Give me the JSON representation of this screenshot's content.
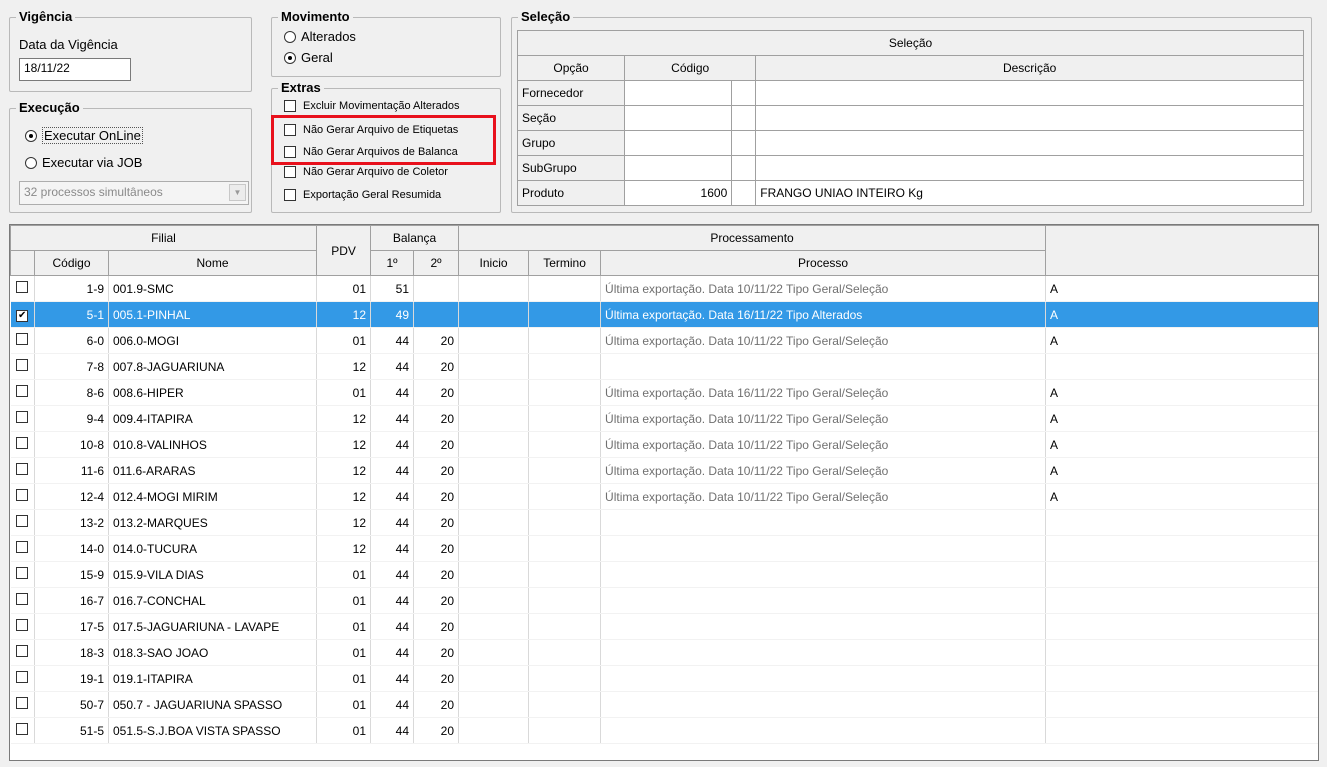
{
  "vigencia": {
    "legend": "Vigência",
    "label": "Data da Vigência",
    "value": "18/11/22"
  },
  "execucao": {
    "legend": "Execução",
    "options": [
      {
        "label": "Executar OnLine",
        "selected": true
      },
      {
        "label": "Executar via JOB",
        "selected": false
      }
    ],
    "combo_value": "32 processos simultâneos"
  },
  "movimento": {
    "legend": "Movimento",
    "options": [
      {
        "label": "Alterados",
        "selected": false
      },
      {
        "label": "Geral",
        "selected": true
      }
    ]
  },
  "extras": {
    "legend": "Extras",
    "options": [
      {
        "label": "Excluir Movimentação Alterados",
        "checked": false
      },
      {
        "label": "Não Gerar Arquivo de Etiquetas",
        "checked": false
      },
      {
        "label": "Não Gerar Arquivos de Balanca",
        "checked": false
      },
      {
        "label": "Não Gerar Arquivo de Coletor",
        "checked": false
      },
      {
        "label": "Exportação Geral Resumida",
        "checked": false
      }
    ]
  },
  "selecao": {
    "legend": "Seleção",
    "table_title": "Seleção",
    "headers": {
      "opcao": "Opção",
      "codigo": "Código",
      "descricao": "Descrição"
    },
    "rows": [
      {
        "opcao": "Fornecedor",
        "codigo": "",
        "descricao": ""
      },
      {
        "opcao": "Seção",
        "codigo": "",
        "descricao": ""
      },
      {
        "opcao": "Grupo",
        "codigo": "",
        "descricao": ""
      },
      {
        "opcao": "SubGrupo",
        "codigo": "",
        "descricao": ""
      },
      {
        "opcao": "Produto",
        "codigo": "1600",
        "descricao": "FRANGO UNIAO INTEIRO Kg"
      }
    ]
  },
  "grid": {
    "headers": {
      "filial": "Filial",
      "pdv": "PDV",
      "balanca": "Balança",
      "processamento": "Processamento",
      "codigo": "Código",
      "nome": "Nome",
      "bal1": "1º",
      "bal2": "2º",
      "inicio": "Inicio",
      "termino": "Termino",
      "processo": "Processo"
    },
    "rows": [
      {
        "checked": false,
        "selected": false,
        "codigo": "1-9",
        "nome": "001.9-SMC",
        "pdv": "01",
        "b1": "51",
        "b2": "",
        "inicio": "",
        "termino": "",
        "processo": "Última exportação. Data 10/11/22 Tipo Geral/Seleção",
        "extra": "A"
      },
      {
        "checked": true,
        "selected": true,
        "codigo": "5-1",
        "nome": "005.1-PINHAL",
        "pdv": "12",
        "b1": "49",
        "b2": "",
        "inicio": "",
        "termino": "",
        "processo": "Última exportação. Data 16/11/22 Tipo Alterados",
        "extra": "A"
      },
      {
        "checked": false,
        "selected": false,
        "codigo": "6-0",
        "nome": "006.0-MOGI",
        "pdv": "01",
        "b1": "44",
        "b2": "20",
        "inicio": "",
        "termino": "",
        "processo": "Última exportação. Data 10/11/22 Tipo Geral/Seleção",
        "extra": "A"
      },
      {
        "checked": false,
        "selected": false,
        "codigo": "7-8",
        "nome": "007.8-JAGUARIUNA",
        "pdv": "12",
        "b1": "44",
        "b2": "20",
        "inicio": "",
        "termino": "",
        "processo": "",
        "extra": ""
      },
      {
        "checked": false,
        "selected": false,
        "codigo": "8-6",
        "nome": "008.6-HIPER",
        "pdv": "01",
        "b1": "44",
        "b2": "20",
        "inicio": "",
        "termino": "",
        "processo": "Última exportação. Data 16/11/22 Tipo Geral/Seleção",
        "extra": "A"
      },
      {
        "checked": false,
        "selected": false,
        "codigo": "9-4",
        "nome": "009.4-ITAPIRA",
        "pdv": "12",
        "b1": "44",
        "b2": "20",
        "inicio": "",
        "termino": "",
        "processo": "Última exportação. Data 10/11/22 Tipo Geral/Seleção",
        "extra": "A"
      },
      {
        "checked": false,
        "selected": false,
        "codigo": "10-8",
        "nome": "010.8-VALINHOS",
        "pdv": "12",
        "b1": "44",
        "b2": "20",
        "inicio": "",
        "termino": "",
        "processo": "Última exportação. Data 10/11/22 Tipo Geral/Seleção",
        "extra": "A"
      },
      {
        "checked": false,
        "selected": false,
        "codigo": "11-6",
        "nome": "011.6-ARARAS",
        "pdv": "12",
        "b1": "44",
        "b2": "20",
        "inicio": "",
        "termino": "",
        "processo": "Última exportação. Data 10/11/22 Tipo Geral/Seleção",
        "extra": "A"
      },
      {
        "checked": false,
        "selected": false,
        "codigo": "12-4",
        "nome": "012.4-MOGI MIRIM",
        "pdv": "12",
        "b1": "44",
        "b2": "20",
        "inicio": "",
        "termino": "",
        "processo": "Última exportação. Data 10/11/22 Tipo Geral/Seleção",
        "extra": "A"
      },
      {
        "checked": false,
        "selected": false,
        "codigo": "13-2",
        "nome": "013.2-MARQUES",
        "pdv": "12",
        "b1": "44",
        "b2": "20",
        "inicio": "",
        "termino": "",
        "processo": "",
        "extra": ""
      },
      {
        "checked": false,
        "selected": false,
        "codigo": "14-0",
        "nome": "014.0-TUCURA",
        "pdv": "12",
        "b1": "44",
        "b2": "20",
        "inicio": "",
        "termino": "",
        "processo": "",
        "extra": ""
      },
      {
        "checked": false,
        "selected": false,
        "codigo": "15-9",
        "nome": "015.9-VILA DIAS",
        "pdv": "01",
        "b1": "44",
        "b2": "20",
        "inicio": "",
        "termino": "",
        "processo": "",
        "extra": ""
      },
      {
        "checked": false,
        "selected": false,
        "codigo": "16-7",
        "nome": "016.7-CONCHAL",
        "pdv": "01",
        "b1": "44",
        "b2": "20",
        "inicio": "",
        "termino": "",
        "processo": "",
        "extra": ""
      },
      {
        "checked": false,
        "selected": false,
        "codigo": "17-5",
        "nome": "017.5-JAGUARIUNA - LAVAPE",
        "pdv": "01",
        "b1": "44",
        "b2": "20",
        "inicio": "",
        "termino": "",
        "processo": "",
        "extra": ""
      },
      {
        "checked": false,
        "selected": false,
        "codigo": "18-3",
        "nome": "018.3-SAO JOAO",
        "pdv": "01",
        "b1": "44",
        "b2": "20",
        "inicio": "",
        "termino": "",
        "processo": "",
        "extra": ""
      },
      {
        "checked": false,
        "selected": false,
        "codigo": "19-1",
        "nome": "019.1-ITAPIRA",
        "pdv": "01",
        "b1": "44",
        "b2": "20",
        "inicio": "",
        "termino": "",
        "processo": "",
        "extra": ""
      },
      {
        "checked": false,
        "selected": false,
        "codigo": "50-7",
        "nome": "050.7 - JAGUARIUNA SPASSO",
        "pdv": "01",
        "b1": "44",
        "b2": "20",
        "inicio": "",
        "termino": "",
        "processo": "",
        "extra": ""
      },
      {
        "checked": false,
        "selected": false,
        "codigo": "51-5",
        "nome": "051.5-S.J.BOA VISTA SPASSO",
        "pdv": "01",
        "b1": "44",
        "b2": "20",
        "inicio": "",
        "termino": "",
        "processo": "",
        "extra": ""
      }
    ]
  },
  "colors": {
    "selection": "#3399e6",
    "highlight_border": "#e8101c"
  }
}
